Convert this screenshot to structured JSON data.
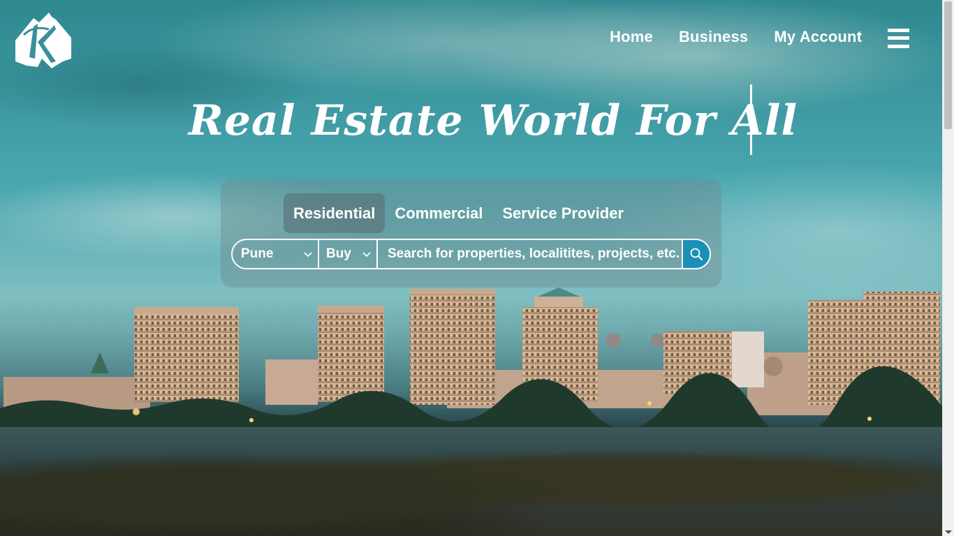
{
  "brand": {
    "logo_icon": "k-house-logo-icon"
  },
  "nav": {
    "items": [
      {
        "label": "Home"
      },
      {
        "label": "Business"
      },
      {
        "label": "My Account"
      }
    ],
    "menu_icon": "hamburger-menu-icon"
  },
  "hero": {
    "headline": "Real Estate World For All"
  },
  "search": {
    "tabs": [
      {
        "label": "Residential",
        "active": true
      },
      {
        "label": "Commercial",
        "active": false
      },
      {
        "label": "Service Provider",
        "active": false
      }
    ],
    "city": "Pune",
    "mode": "Buy",
    "placeholder": "Search for properties, localitites, projects, etc.",
    "button_icon": "search-icon",
    "button_color": "#1a90b8"
  }
}
